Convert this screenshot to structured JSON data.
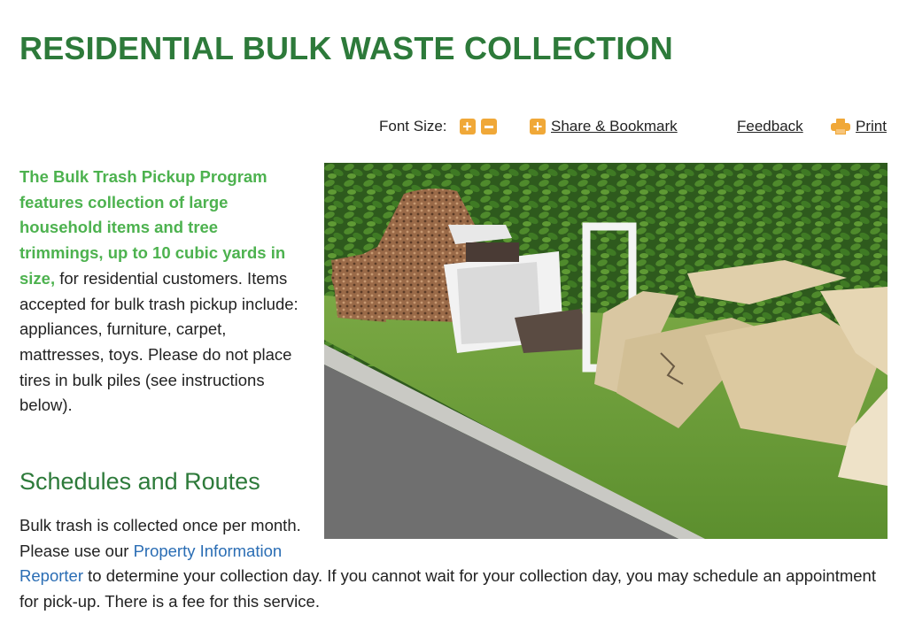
{
  "page": {
    "title": "RESIDENTIAL BULK WASTE COLLECTION"
  },
  "toolbar": {
    "font_size_label": "Font Size:",
    "share_label": "Share & Bookmark",
    "feedback_label": "Feedback",
    "print_label": "Print",
    "icon_color": "#f0a838"
  },
  "intro": {
    "lead_text": "The Bulk Trash Pickup Program features collection of large household items and tree trimmings, up to 10 cubic yards in size,",
    "rest_text": " for residential customers. Items accepted for bulk trash pickup include: appliances, furniture, carpet, mattresses, toys. Please do not place tires in bulk piles (see instructions below)."
  },
  "schedules": {
    "heading": "Schedules and Routes",
    "text_before_link": "Bulk trash is collected once per month. Please use our ",
    "link_text": "Property Information Reporter",
    "text_after_link": " to determine your collection day. If you cannot wait for your collection day, you may schedule an appointment for pick-up. There is a fee for this service."
  },
  "colors": {
    "heading_green": "#2d7a3a",
    "lead_green": "#4db24f",
    "link_blue": "#2a6db4"
  }
}
